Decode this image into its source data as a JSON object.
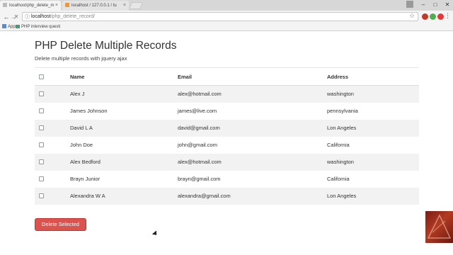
{
  "browser": {
    "tabs": [
      {
        "title": "localhost/php_delete_m",
        "active": true
      },
      {
        "title": "localhost / 127.0.0.1 / tu",
        "active": false
      }
    ],
    "address": {
      "host": "localhost",
      "path": "/php_delete_record/"
    },
    "bookmarks": [
      {
        "label": "Apps",
        "icon": "apps-icon"
      },
      {
        "label": "PHP interview questi",
        "icon": "bookmark-icon"
      }
    ],
    "extension_colors": [
      "#c0392b",
      "#4caf50",
      "#e53935"
    ]
  },
  "page": {
    "title": "PHP Delete Multiple Records",
    "subtitle": "Delete multiple records with jquery ajax"
  },
  "table": {
    "headers": {
      "name": "Name",
      "email": "Email",
      "address": "Address"
    },
    "rows": [
      {
        "name": "Alex J",
        "email": "alex@hotmail.com",
        "address": "washington"
      },
      {
        "name": "James Johnson",
        "email": "james@live.com",
        "address": "pennsylvania"
      },
      {
        "name": "David L A",
        "email": "david@gmail.com",
        "address": "Lon Angeles"
      },
      {
        "name": "John Doe",
        "email": "john@gmail.com",
        "address": "California"
      },
      {
        "name": "Alex Bedford",
        "email": "alex@hotmail.com",
        "address": "washington"
      },
      {
        "name": "Brayn Junior",
        "email": "brayn@gmail.com",
        "address": "California"
      },
      {
        "name": "Alexandra W A",
        "email": "alexandra@gmail.com",
        "address": "Lon Angeles"
      }
    ]
  },
  "actions": {
    "delete_label": "Delete Selected",
    "delete_color": "#d9534f"
  }
}
